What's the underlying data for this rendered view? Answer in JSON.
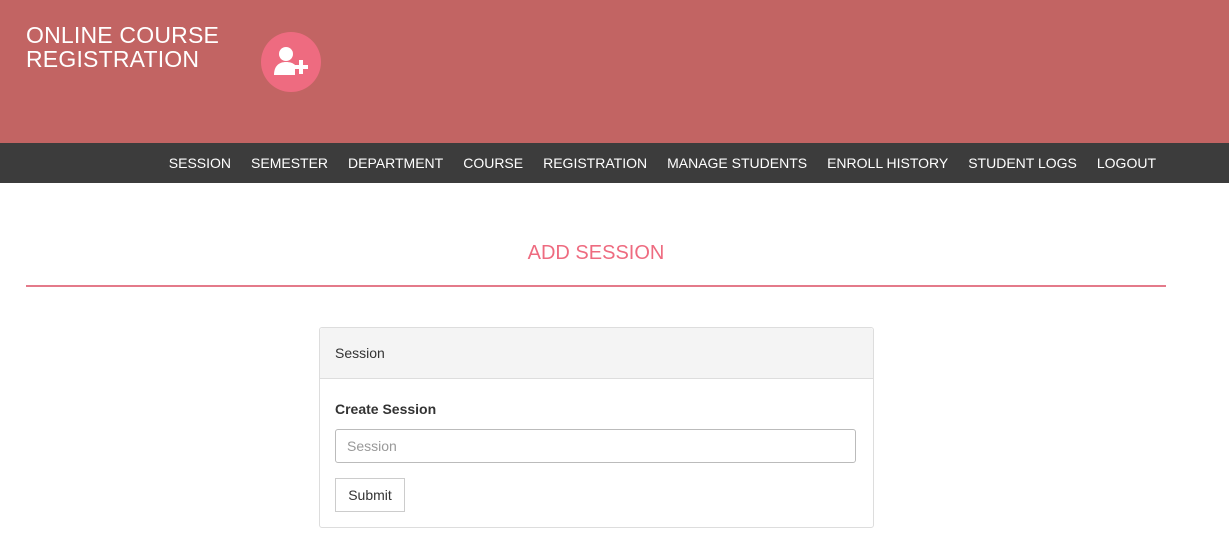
{
  "header": {
    "brand_line1": "ONLINE COURSE",
    "brand_line2": "REGISTRATION",
    "logo_icon": "add-user-icon",
    "background_color": "#c26463",
    "logo_color": "#ee6b80"
  },
  "nav": {
    "items": [
      {
        "label": "SESSION"
      },
      {
        "label": "SEMESTER"
      },
      {
        "label": "DEPARTMENT"
      },
      {
        "label": "COURSE"
      },
      {
        "label": "REGISTRATION"
      },
      {
        "label": "MANAGE STUDENTS"
      },
      {
        "label": "ENROLL HISTORY"
      },
      {
        "label": "STUDENT LOGS"
      },
      {
        "label": "LOGOUT"
      }
    ],
    "background_color": "#3c3c3c"
  },
  "main": {
    "page_title": "ADD SESSION",
    "accent_color": "#ee6b80",
    "panel": {
      "heading": "Session",
      "field_label": "Create Session",
      "input_value": "",
      "input_placeholder": "Session",
      "submit_label": "Submit"
    }
  }
}
